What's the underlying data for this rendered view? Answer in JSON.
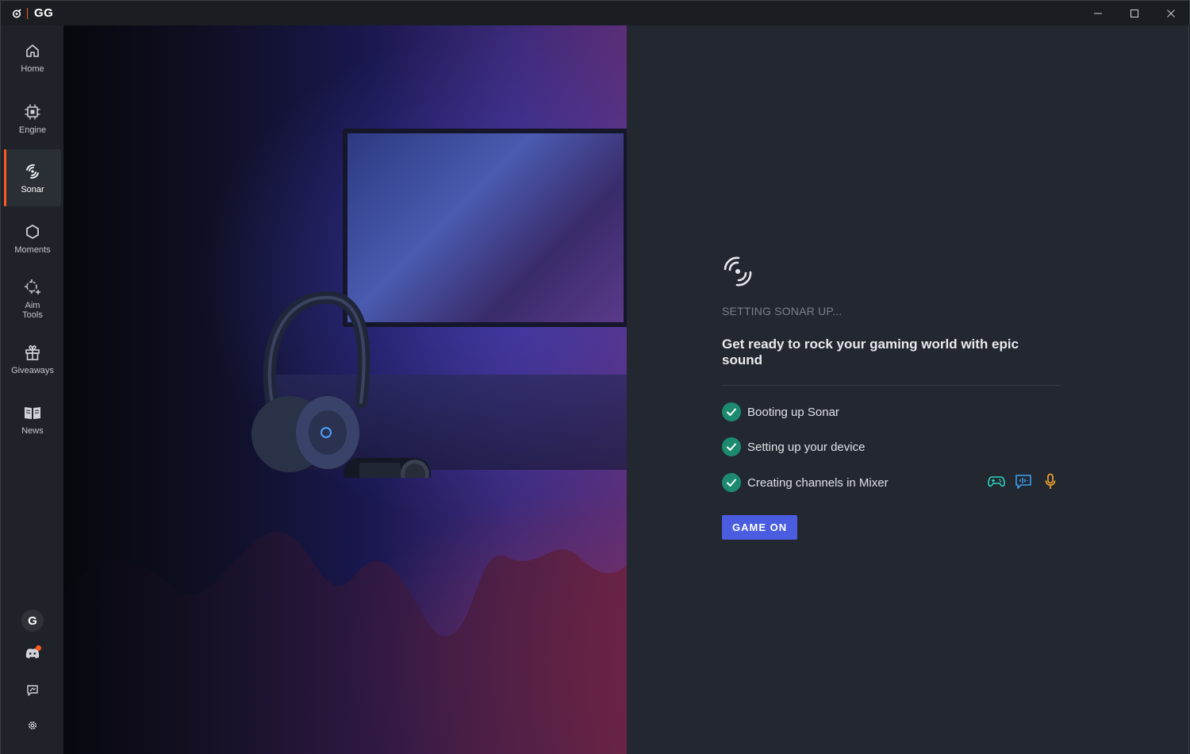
{
  "app": {
    "title": "GG"
  },
  "window_controls": {
    "minimize_icon": "minimize-icon",
    "maximize_icon": "maximize-icon",
    "close_icon": "close-icon"
  },
  "sidebar": {
    "items": [
      {
        "label": "Home",
        "icon": "home-icon"
      },
      {
        "label": "Engine",
        "icon": "chip-icon"
      },
      {
        "label": "Sonar",
        "icon": "sonar-icon",
        "active": true
      },
      {
        "label": "Moments",
        "icon": "hexagon-icon"
      },
      {
        "label": "Aim\nTools",
        "line1": "Aim",
        "line2": "Tools",
        "icon": "crosshair-icon"
      },
      {
        "label": "Giveaways",
        "icon": "gift-icon"
      },
      {
        "label": "News",
        "icon": "book-icon"
      }
    ],
    "bottom": {
      "avatar_letter": "G",
      "discord_icon": "discord-icon",
      "feedback_icon": "feedback-icon",
      "settings_icon": "gear-icon"
    }
  },
  "main": {
    "icon": "sonar-icon",
    "status": "SETTING SONAR UP...",
    "headline": "Get ready to rock your gaming world with epic sound",
    "steps": [
      {
        "label": "Booting up Sonar",
        "done": true
      },
      {
        "label": "Setting up your device",
        "done": true
      },
      {
        "label": "Creating channels in Mixer",
        "done": true
      }
    ],
    "channel_icons": [
      "gamepad-icon",
      "chat-icon",
      "microphone-icon"
    ],
    "cta_label": "GAME ON"
  },
  "colors": {
    "accent": "#ff5a1f",
    "button": "#4a5ce0",
    "check": "#1c8a6e",
    "game": "#2bd4c0",
    "chat": "#3aa0f0",
    "mic": "#f0a030"
  }
}
